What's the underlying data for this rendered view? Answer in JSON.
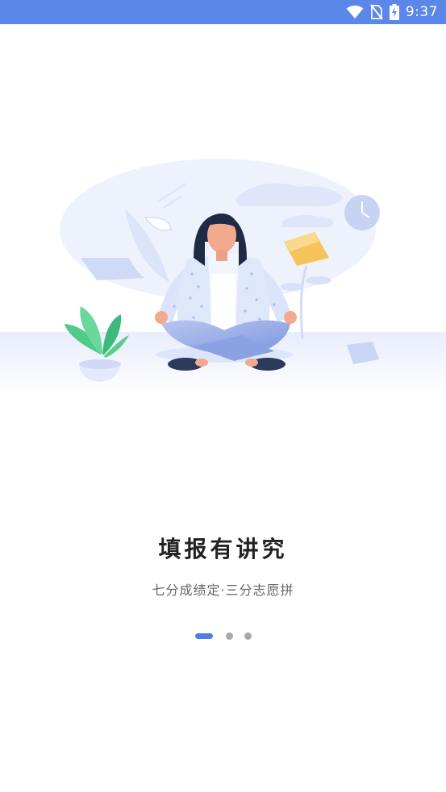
{
  "status_bar": {
    "time": "9:37",
    "background": "#5b86ea",
    "icons": [
      "wifi-icon",
      "no-sim-icon",
      "battery-charging-icon"
    ]
  },
  "illustration": {
    "subject": "meditating-woman-icon"
  },
  "onboarding": {
    "title": "填报有讲究",
    "subtitle": "七分成绩定·三分志愿拼"
  },
  "pager": {
    "page_count": 3,
    "active_index": 0,
    "active_color": "#4f7ee8",
    "inactive_color": "#a8a8a8"
  }
}
